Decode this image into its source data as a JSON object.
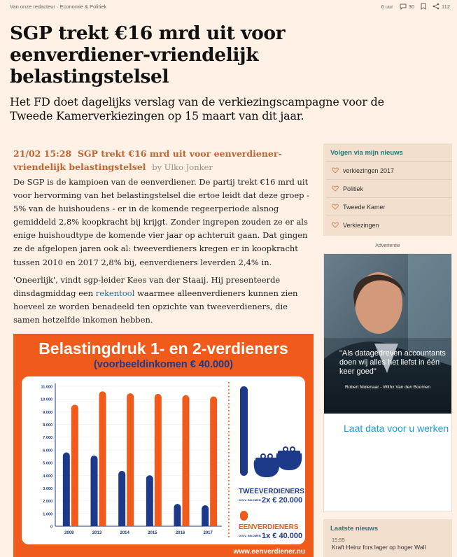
{
  "topbar": {
    "breadcrumb": "Van onze redacteur · Economie & Politiek",
    "time": "6 uur",
    "comments": "30",
    "shares": "112"
  },
  "article": {
    "headline": "SGP trekt €16 mrd uit voor eenverdiener-vriendelijk belastingstelsel",
    "standfirst": "Het FD doet dagelijks verslag van de verkiezingscampagne voor de Tweede Kamerverkiezingen op 15 maart van dit jaar."
  },
  "post": {
    "time": "21/02 15:28",
    "title": "SGP trekt €16 mrd uit voor eenverdiener-vriendelijk belastingstelsel",
    "byline": "by Ulko Jonker",
    "para1": "De SGP is de kampioen van de eenverdiener. De partij trekt €16 mrd uit voor hervorming van het belastingstelsel die ertoe leidt dat deze groep - 5% van de huishoudens - er in de komende regeerperiode alsnog gemiddeld 2,8% koopkracht bij krijgt. Zonder ingrepen zouden ze er als enige huishoudtype de komende vier jaar op achteruit gaan. Dat gingen ze de afgelopen jaren ook al: tweeverdieners kregen er in koopkracht tussen 2010 en 2017 2,8% bij, eenverdieners leverden 2,4% in.",
    "para2_before": "'Oneerlijk', vindt sgp-leider Kees van der Staaij. Hij presenteerde dinsdagmiddag een ",
    "para2_link": "rekentool",
    "para2_after": " waarmee alleenverdieners kunnen zien hoeveel ze worden benadeeld ten opzichte van tweeverdieners, die samen hetzelfde inkomen hebben."
  },
  "infographic": {
    "title": "Belastingdruk 1- en 2-verdieners",
    "subtitle": "(voorbeeldinkomen € 40.000)",
    "footer": "www.eenverdiener.nu",
    "two_label": "TWEEVERDIENERS",
    "two_sub": "O.B.V. INKOMEN",
    "two_amount": "2x € 20.000",
    "one_label": "EENVERDIENERS",
    "one_sub": "O.B.V. INKOMEN",
    "one_amount": "1x € 40.000",
    "colors": {
      "blue": "#1d3a8a",
      "orange": "#f05a1a"
    }
  },
  "chart_data": {
    "type": "bar",
    "categories": [
      "2008",
      "2013",
      "2014",
      "2015",
      "2016",
      "2017"
    ],
    "yticks": [
      "11.000",
      "10.000",
      "9.000",
      "8.000",
      "7.000",
      "6.000",
      "5.000",
      "4.000",
      "3.000",
      "2.000",
      "1.000",
      "0"
    ],
    "ylim": [
      0,
      11000
    ],
    "series": [
      {
        "color": "#1d3a8a",
        "values": [
          5800,
          5550,
          4350,
          4000,
          1750,
          1650
        ]
      },
      {
        "color": "#f05a1a",
        "values": [
          9550,
          10600,
          10450,
          10400,
          10300,
          10200
        ]
      }
    ]
  },
  "sidebar": {
    "follow_title": "Volgen via mijn nieuws",
    "follow_items": [
      "verkiezingen 2017",
      "Politiek",
      "Tweede Kamer",
      "Verkiezingen"
    ],
    "ad_label": "Advertentie",
    "ad_quote": "\"Als datagedreven accountants doen wij alles het liefst in één keer goed\"",
    "ad_quote_by": "Robert Molenaar - Withx Van den Boomen",
    "ad_cta": "Laat data voor u werken",
    "latest_title": "Laatste nieuws",
    "latest_time": "15:55",
    "latest_item": "Kraft Heinz fors lager op hoger Wall"
  }
}
